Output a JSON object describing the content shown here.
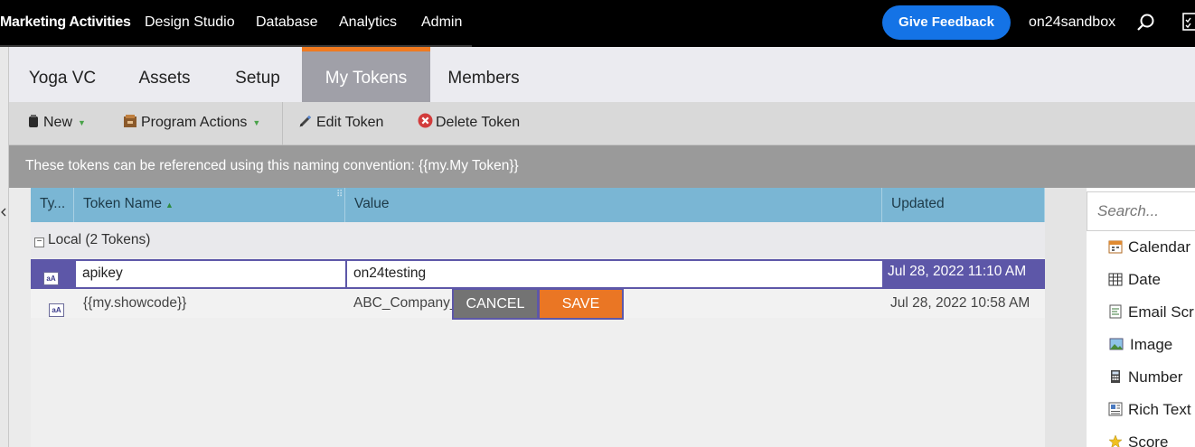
{
  "topnav": {
    "items": [
      "Marketing Activities",
      "Design Studio",
      "Database",
      "Analytics",
      "Admin"
    ],
    "feedback_label": "Give Feedback",
    "user": "on24sandbox"
  },
  "tabs": [
    "Yoga VC",
    "Assets",
    "Setup",
    "My Tokens",
    "Members"
  ],
  "active_tab": "My Tokens",
  "toolbar": {
    "new_label": "New",
    "program_actions_label": "Program Actions",
    "edit_token_label": "Edit Token",
    "delete_token_label": "Delete Token"
  },
  "info_text": "These tokens can be referenced using this naming convention: {{my.My Token}}",
  "grid": {
    "columns": [
      "Ty...",
      "Token Name",
      "Value",
      "Updated"
    ],
    "group_label": "Local (2 Tokens)",
    "rows": [
      {
        "name": "apikey",
        "value": "on24testing",
        "updated": "Jul 28, 2022 11:10 AM"
      },
      {
        "name": "{{my.showcode}}",
        "value": "ABC_Company_",
        "updated": "Jul 28, 2022 10:58 AM"
      }
    ],
    "cancel_label": "CANCEL",
    "save_label": "SAVE"
  },
  "right_panel": {
    "search_placeholder": "Search...",
    "items": [
      "Calendar",
      "Date",
      "Email Scr",
      "Image",
      "Number",
      "Rich Text",
      "Score"
    ]
  }
}
